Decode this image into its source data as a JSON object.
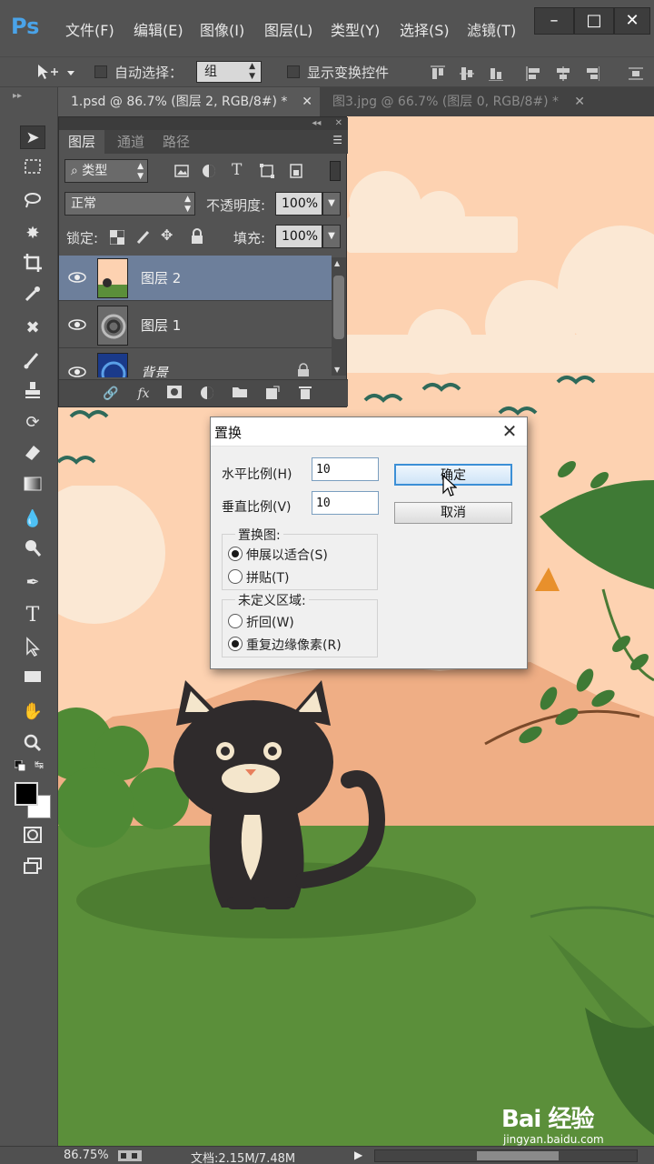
{
  "app": {
    "logo": "Ps",
    "menu": [
      "文件(F)",
      "编辑(E)",
      "图像(I)",
      "图层(L)",
      "类型(Y)",
      "选择(S)",
      "滤镜(T)"
    ],
    "window_buttons": [
      "minimize",
      "maximize",
      "close"
    ]
  },
  "options_bar": {
    "auto_select_label": "自动选择：",
    "auto_select_value": "组",
    "show_transform_label": "显示变换控件"
  },
  "doc_tabs": [
    {
      "label": "1.psd @ 86.7% (图层 2, RGB/8#) *",
      "active": true
    },
    {
      "label": "图3.jpg @ 66.7% (图层 0, RGB/8#) *",
      "active": false
    }
  ],
  "layers_panel": {
    "tabs": [
      "图层",
      "通道",
      "路径"
    ],
    "filter_label": "类型",
    "blend_mode": "正常",
    "opacity_label": "不透明度:",
    "opacity_value": "100%",
    "lock_label": "锁定:",
    "fill_label": "填充:",
    "fill_value": "100%",
    "layers": [
      {
        "name": "图层 2",
        "selected": true,
        "thumb": "scene"
      },
      {
        "name": "图层 1",
        "selected": false,
        "thumb": "swirl"
      },
      {
        "name": "背景",
        "selected": false,
        "thumb": "blue-swirl"
      }
    ]
  },
  "dialog": {
    "title": "置换",
    "horizontal_label": "水平比例(H)",
    "horizontal_value": "10",
    "vertical_label": "垂直比例(V)",
    "vertical_value": "10",
    "ok_label": "确定",
    "cancel_label": "取消",
    "map_group_label": "置换图:",
    "map_options": [
      {
        "label": "伸展以适合(S)",
        "checked": true
      },
      {
        "label": "拼贴(T)",
        "checked": false
      }
    ],
    "undefined_group_label": "未定义区域:",
    "undefined_options": [
      {
        "label": "折回(W)",
        "checked": false
      },
      {
        "label": "重复边缘像素(R)",
        "checked": true
      }
    ]
  },
  "status": {
    "zoom": "86.75%",
    "doc_info": "文档:2.15M/7.48M"
  },
  "watermark": {
    "logo": "Bai 经验",
    "url": "jingyan.baidu.com"
  },
  "colors": {
    "ui_bg": "#535353",
    "canvas_sky": "#fdd2b1",
    "grass": "#5b8f3a",
    "selected_layer": "#6d7f9b"
  }
}
